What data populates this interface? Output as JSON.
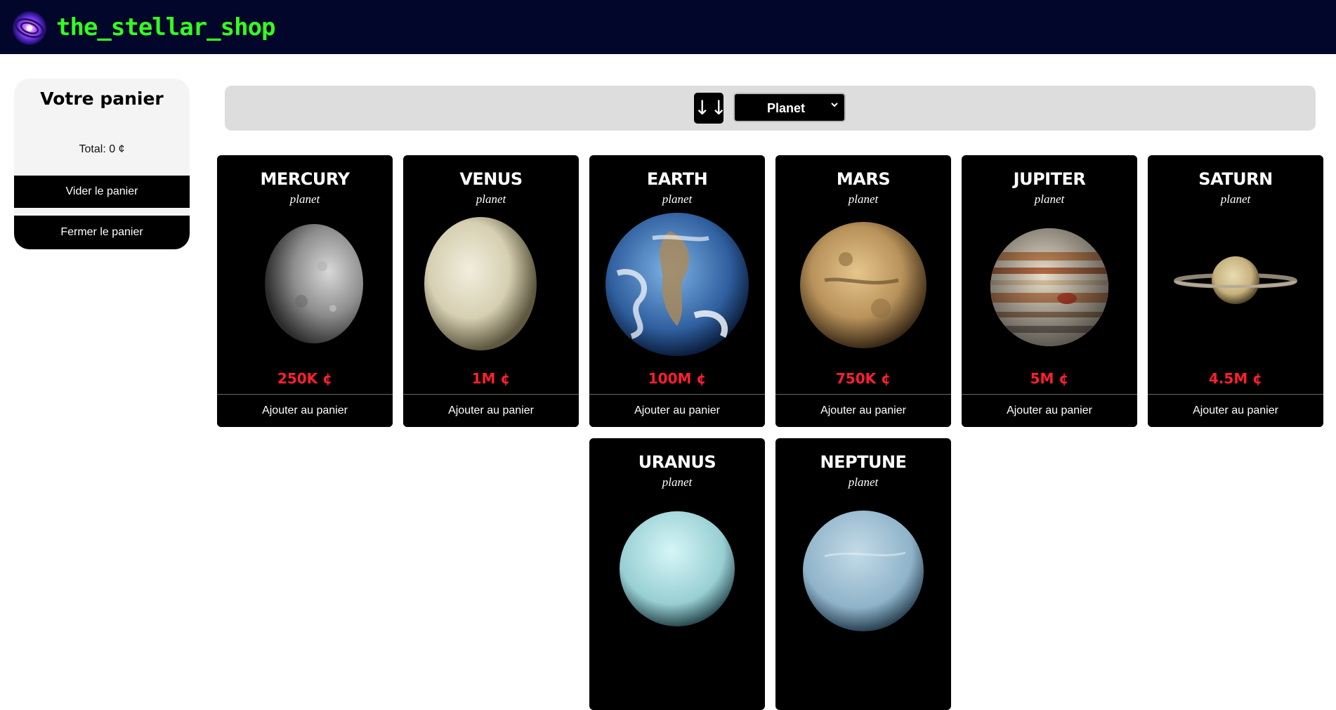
{
  "header": {
    "brand": "the_stellar_shop",
    "logo_icon": "galaxy-icon"
  },
  "cart": {
    "title": "Votre panier",
    "total": "Total: 0 ¢",
    "empty_label": "Vider le panier",
    "close_label": "Fermer le panier"
  },
  "toolbar": {
    "sort_icon": "↓↓",
    "category": {
      "selected": "Planet",
      "icon": "chevron-down-icon"
    }
  },
  "products": [
    {
      "name": "MERCURY",
      "type": "planet",
      "price": "250K ¢",
      "add_label": "Ajouter au panier"
    },
    {
      "name": "VENUS",
      "type": "planet",
      "price": "1M ¢",
      "add_label": "Ajouter au panier"
    },
    {
      "name": "EARTH",
      "type": "planet",
      "price": "100M ¢",
      "add_label": "Ajouter au panier"
    },
    {
      "name": "MARS",
      "type": "planet",
      "price": "750K ¢",
      "add_label": "Ajouter au panier"
    },
    {
      "name": "JUPITER",
      "type": "planet",
      "price": "5M ¢",
      "add_label": "Ajouter au panier"
    },
    {
      "name": "SATURN",
      "type": "planet",
      "price": "4.5M ¢",
      "add_label": "Ajouter au panier"
    },
    {
      "name": "URANUS",
      "type": "planet"
    },
    {
      "name": "NEPTUNE",
      "type": "planet"
    }
  ],
  "colors": {
    "header_bg": "#02062a",
    "brand": "#33ff22",
    "price": "#ff1f2f",
    "card_bg": "#000000",
    "toolbar_bg": "#dddddd"
  }
}
